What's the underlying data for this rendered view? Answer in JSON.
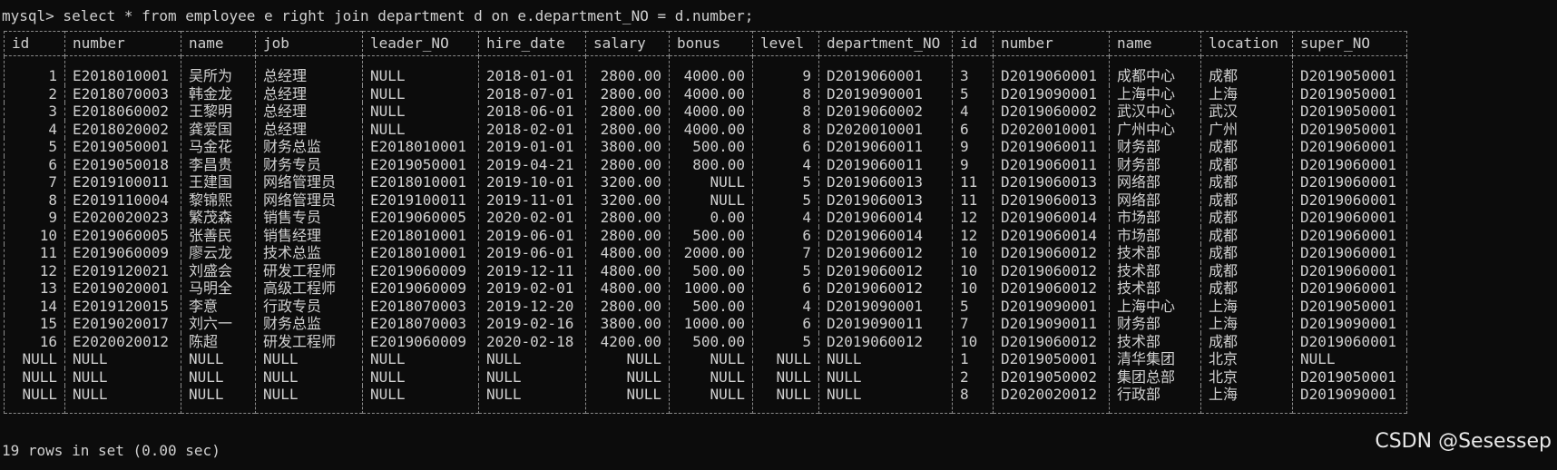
{
  "terminal": {
    "command_line": "mysql> select * from employee e right join department d on e.department_NO = d.number;",
    "status_line": "19 rows in set (0.00 sec)"
  },
  "watermark": "CSDN @Sesessep",
  "table": {
    "headers": [
      "id",
      "number",
      "name",
      "job",
      "leader_NO",
      "hire_date",
      "salary",
      "bonus",
      "level",
      "department_NO",
      "id",
      "number",
      "name",
      "location",
      "super_NO"
    ],
    "rows": [
      [
        "1",
        "E2018010001",
        "吴所为",
        "总经理",
        "NULL",
        "2018-01-01",
        "2800.00",
        "4000.00",
        "9",
        "D2019060001",
        "3",
        "D2019060001",
        "成都中心",
        "成都",
        "D2019050001"
      ],
      [
        "2",
        "E2018070003",
        "韩金龙",
        "总经理",
        "NULL",
        "2018-07-01",
        "2800.00",
        "4000.00",
        "8",
        "D2019090001",
        "5",
        "D2019090001",
        "上海中心",
        "上海",
        "D2019050001"
      ],
      [
        "3",
        "E2018060002",
        "王黎明",
        "总经理",
        "NULL",
        "2018-06-01",
        "2800.00",
        "4000.00",
        "8",
        "D2019060002",
        "4",
        "D2019060002",
        "武汉中心",
        "武汉",
        "D2019050001"
      ],
      [
        "4",
        "E2018020002",
        "龚爱国",
        "总经理",
        "NULL",
        "2018-02-01",
        "2800.00",
        "4000.00",
        "8",
        "D2020010001",
        "6",
        "D2020010001",
        "广州中心",
        "广州",
        "D2019050001"
      ],
      [
        "5",
        "E2019050001",
        "马金花",
        "财务总监",
        "E2018010001",
        "2019-01-01",
        "3800.00",
        "500.00",
        "6",
        "D2019060011",
        "9",
        "D2019060011",
        "财务部",
        "成都",
        "D2019060001"
      ],
      [
        "6",
        "E2019050018",
        "李昌贵",
        "财务专员",
        "E2019050001",
        "2019-04-21",
        "2800.00",
        "800.00",
        "4",
        "D2019060011",
        "9",
        "D2019060011",
        "财务部",
        "成都",
        "D2019060001"
      ],
      [
        "7",
        "E2019100011",
        "王建国",
        "网络管理员",
        "E2018010001",
        "2019-10-01",
        "3200.00",
        "NULL",
        "5",
        "D2019060013",
        "11",
        "D2019060013",
        "网络部",
        "成都",
        "D2019060001"
      ],
      [
        "8",
        "E2019110004",
        "黎锦熙",
        "网络管理员",
        "E2019100011",
        "2019-11-01",
        "3200.00",
        "NULL",
        "5",
        "D2019060013",
        "11",
        "D2019060013",
        "网络部",
        "成都",
        "D2019060001"
      ],
      [
        "9",
        "E2020020023",
        "繁茂森",
        "销售专员",
        "E2019060005",
        "2020-02-01",
        "2800.00",
        "0.00",
        "4",
        "D2019060014",
        "12",
        "D2019060014",
        "市场部",
        "成都",
        "D2019060001"
      ],
      [
        "10",
        "E2019060005",
        "张善民",
        "销售经理",
        "E2018010001",
        "2019-06-01",
        "2800.00",
        "500.00",
        "6",
        "D2019060014",
        "12",
        "D2019060014",
        "市场部",
        "成都",
        "D2019060001"
      ],
      [
        "11",
        "E2019060009",
        "廖云龙",
        "技术总监",
        "E2018010001",
        "2019-06-01",
        "4800.00",
        "2000.00",
        "7",
        "D2019060012",
        "10",
        "D2019060012",
        "技术部",
        "成都",
        "D2019060001"
      ],
      [
        "12",
        "E2019120021",
        "刘盛会",
        "研发工程师",
        "E2019060009",
        "2019-12-11",
        "4800.00",
        "500.00",
        "5",
        "D2019060012",
        "10",
        "D2019060012",
        "技术部",
        "成都",
        "D2019060001"
      ],
      [
        "13",
        "E2019020001",
        "马明全",
        "高级工程师",
        "E2019060009",
        "2019-02-01",
        "4800.00",
        "1000.00",
        "6",
        "D2019060012",
        "10",
        "D2019060012",
        "技术部",
        "成都",
        "D2019060001"
      ],
      [
        "14",
        "E2019120015",
        "李意",
        "行政专员",
        "E2018070003",
        "2019-12-20",
        "2800.00",
        "500.00",
        "4",
        "D2019090001",
        "5",
        "D2019090001",
        "上海中心",
        "上海",
        "D2019050001"
      ],
      [
        "15",
        "E2019020017",
        "刘六一",
        "财务总监",
        "E2018070003",
        "2019-02-16",
        "3800.00",
        "1000.00",
        "6",
        "D2019090011",
        "7",
        "D2019090011",
        "财务部",
        "上海",
        "D2019090001"
      ],
      [
        "16",
        "E2020020012",
        "陈超",
        "研发工程师",
        "E2019060009",
        "2020-02-18",
        "4200.00",
        "500.00",
        "5",
        "D2019060012",
        "10",
        "D2019060012",
        "技术部",
        "成都",
        "D2019060001"
      ],
      [
        "NULL",
        "NULL",
        "NULL",
        "NULL",
        "NULL",
        "NULL",
        "NULL",
        "NULL",
        "NULL",
        "NULL",
        "1",
        "D2019050001",
        "清华集团",
        "北京",
        "NULL"
      ],
      [
        "NULL",
        "NULL",
        "NULL",
        "NULL",
        "NULL",
        "NULL",
        "NULL",
        "NULL",
        "NULL",
        "NULL",
        "2",
        "D2019050002",
        "集团总部",
        "北京",
        "D2019050001"
      ],
      [
        "NULL",
        "NULL",
        "NULL",
        "NULL",
        "NULL",
        "NULL",
        "NULL",
        "NULL",
        "NULL",
        "NULL",
        "8",
        "D2020020012",
        "行政部",
        "上海",
        "D2019090001"
      ]
    ]
  }
}
